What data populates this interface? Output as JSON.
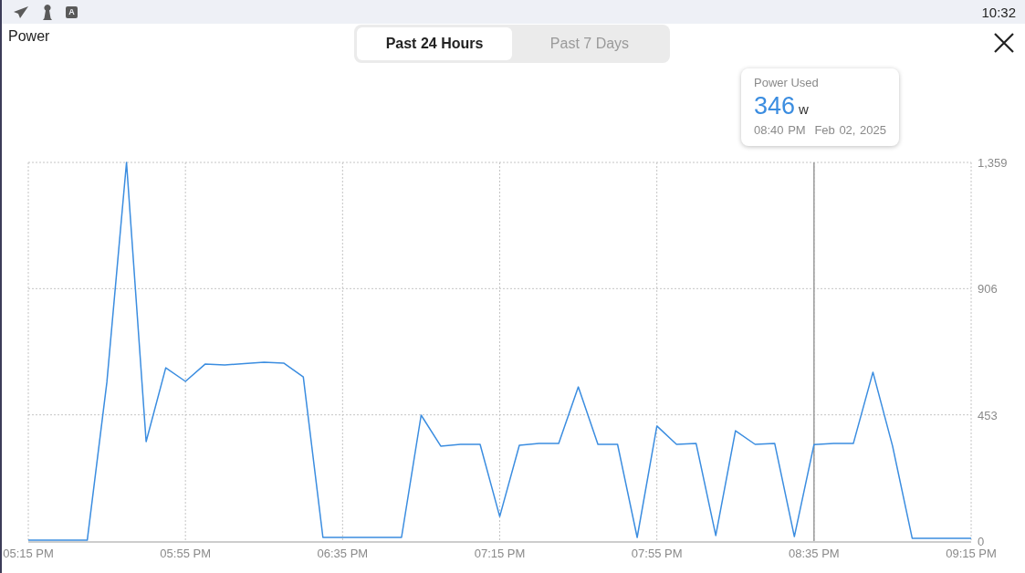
{
  "status_bar": {
    "badge": "A",
    "time": "10:32"
  },
  "header": {
    "title": "Power"
  },
  "tabs": [
    {
      "label": "Past 24 Hours",
      "selected": true
    },
    {
      "label": "Past 7 Days",
      "selected": false
    }
  ],
  "tooltip": {
    "value": "346",
    "unit": "w",
    "time": "08:40 PM",
    "date": "Feb 02, 2025"
  },
  "chart_data": {
    "type": "line",
    "ylim": [
      0,
      1359
    ],
    "categories": [
      "05:15 PM",
      null,
      null,
      null,
      null,
      null,
      null,
      null,
      "05:55 PM",
      null,
      null,
      null,
      null,
      null,
      null,
      null,
      "06:35 PM",
      null,
      null,
      null,
      null,
      null,
      null,
      null,
      "07:15 PM",
      null,
      null,
      null,
      null,
      null,
      null,
      null,
      "07:55 PM",
      null,
      null,
      null,
      null,
      null,
      null,
      null,
      "08:35 PM",
      null,
      null,
      null,
      null,
      null,
      null,
      null,
      "09:15 PM"
    ],
    "yticks": [
      {
        "value": 0,
        "label": "0"
      },
      {
        "value": 453,
        "label": "453"
      },
      {
        "value": 906,
        "label": "906"
      },
      {
        "value": 1359,
        "label": "1,359"
      }
    ],
    "series": [
      {
        "name": "Power Used",
        "color": "#3b8de0",
        "values": [
          3,
          3,
          3,
          3,
          570,
          1359,
          357,
          622,
          573,
          635,
          632,
          637,
          642,
          639,
          589,
          13,
          13,
          13,
          13,
          13,
          452,
          341,
          347,
          347,
          88,
          344,
          350,
          350,
          553,
          347,
          347,
          13,
          413,
          347,
          350,
          20,
          396,
          347,
          350,
          16,
          346,
          350,
          350,
          606,
          341,
          10,
          10,
          10,
          10
        ]
      }
    ],
    "grid": true,
    "annotations": [
      {
        "x": "08:35 PM"
      }
    ]
  }
}
